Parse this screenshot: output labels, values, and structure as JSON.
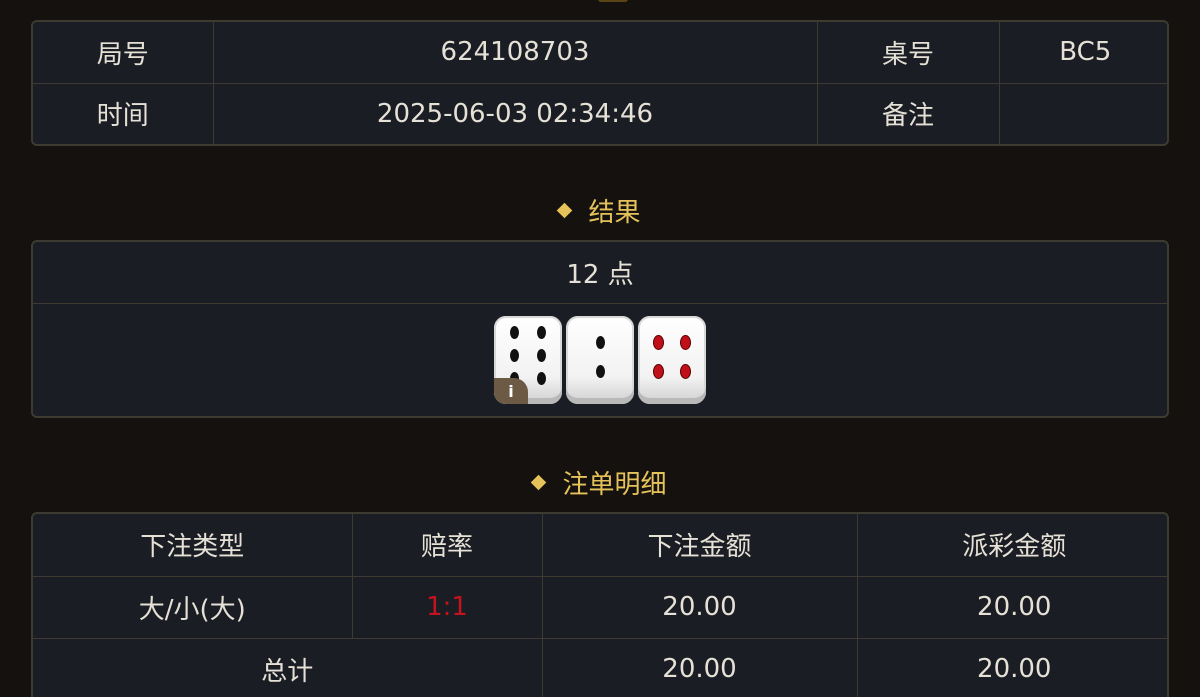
{
  "info": {
    "round_label": "局号",
    "round_value": "624108703",
    "table_label": "桌号",
    "table_value": "BC5",
    "time_label": "时间",
    "time_value": "2025-06-03 02:34:46",
    "remark_label": "备注",
    "remark_value": ""
  },
  "result": {
    "title": "结果",
    "points": "12 点",
    "dice": [
      6,
      2,
      4
    ],
    "info_badge": "i"
  },
  "bets": {
    "title": "注单明细",
    "headers": [
      "下注类型",
      "赔率",
      "下注金额",
      "派彩金额"
    ],
    "rows": [
      {
        "type": "大/小(大)",
        "odds": "1:1",
        "amount": "20.00",
        "payout": "20.00"
      }
    ],
    "total": {
      "label": "总计",
      "amount": "20.00",
      "payout": "20.00"
    }
  },
  "colors": {
    "accent": "#e6c25a",
    "odds_red": "#c4121f",
    "background": "#14110e",
    "panel": "#1b1d24"
  }
}
